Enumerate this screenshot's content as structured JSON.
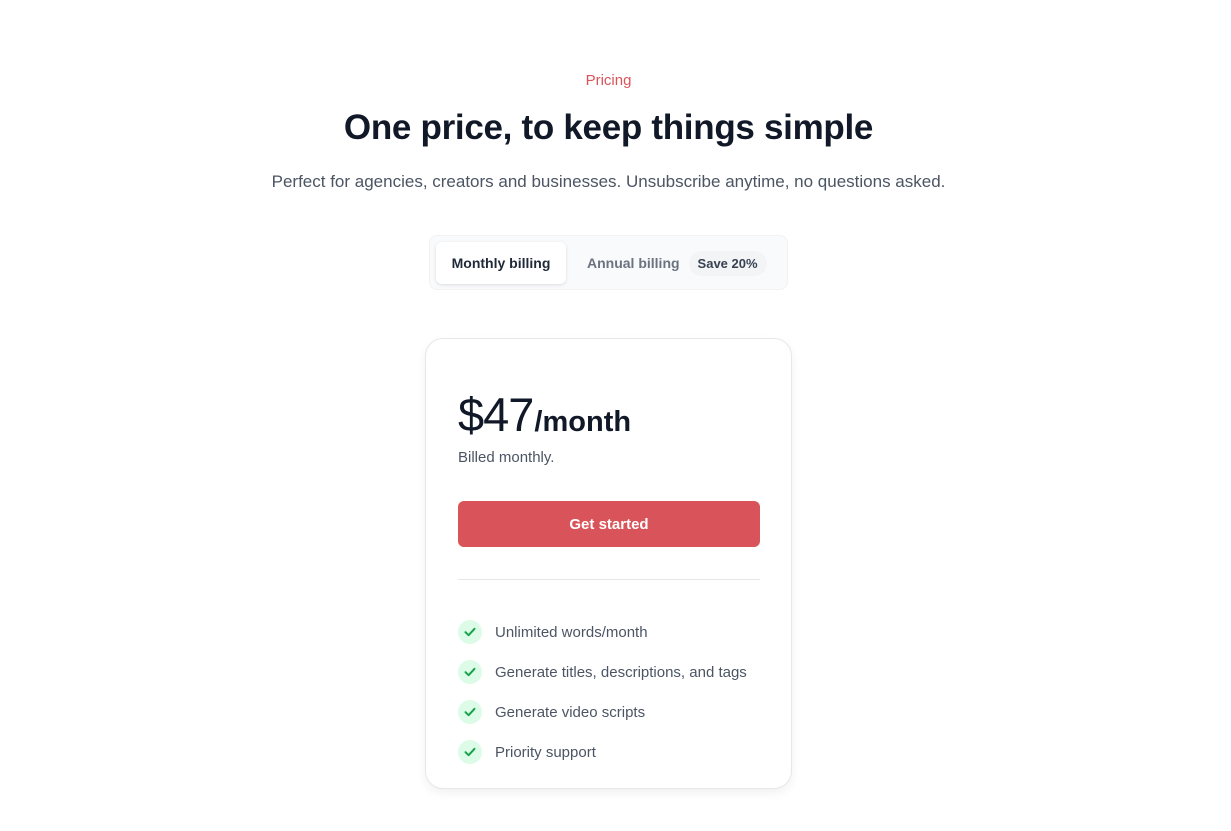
{
  "header": {
    "eyebrow": "Pricing",
    "title": "One price, to keep things simple",
    "subtitle": "Perfect for agencies, creators and businesses. Unsubscribe anytime, no questions asked."
  },
  "billing_toggle": {
    "monthly_label": "Monthly billing",
    "annual_label": "Annual billing",
    "annual_badge": "Save 20%",
    "selected": "Monthly billing"
  },
  "plan": {
    "price": "$47",
    "period": "/month",
    "billing_note": "Billed monthly.",
    "cta_label": "Get started",
    "features": [
      {
        "label": "Unlimited words/month",
        "icon": "check-icon"
      },
      {
        "label": "Generate titles, descriptions, and tags",
        "icon": "check-icon"
      },
      {
        "label": "Generate video scripts",
        "icon": "check-icon"
      },
      {
        "label": "Priority support",
        "icon": "check-icon"
      }
    ]
  },
  "colors": {
    "accent": "#d9545a",
    "check_bg": "#dcfce7",
    "check_mark": "#16a34a",
    "heading": "#111827",
    "body_text": "#4b5563"
  }
}
